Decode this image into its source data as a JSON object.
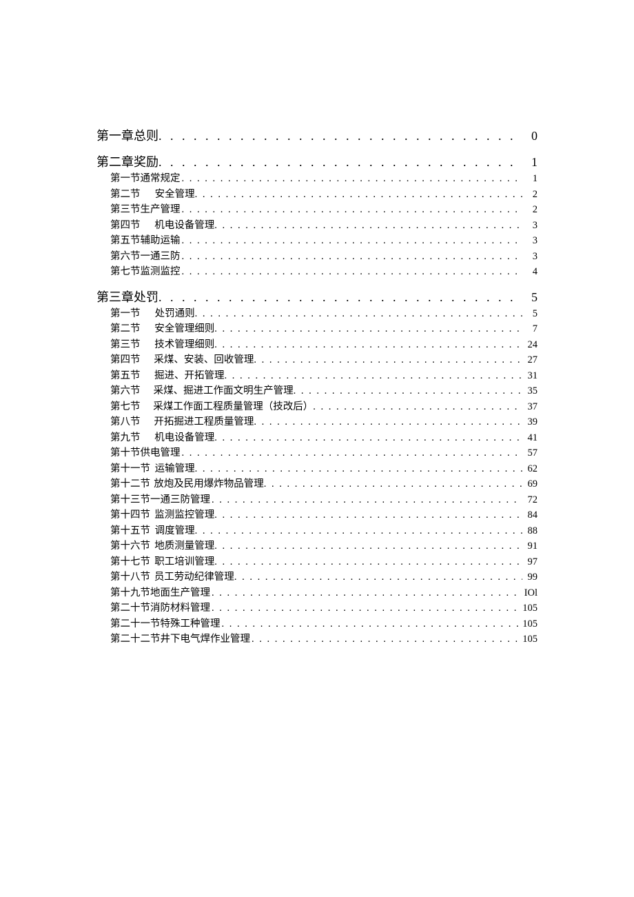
{
  "toc": [
    {
      "level": 0,
      "label": "第一章总则",
      "title": "",
      "page": "0",
      "tight": true
    },
    {
      "level": 0,
      "label": "第二章奖励",
      "title": "",
      "page": "1",
      "tight": true
    },
    {
      "level": 1,
      "label": "第一节通常规定",
      "title": "",
      "page": "1",
      "tight": true
    },
    {
      "level": 1,
      "label": "第二节",
      "title": "安全管理",
      "page": "2"
    },
    {
      "level": 1,
      "label": "第三节生产管理",
      "title": "",
      "page": "2",
      "tight": true
    },
    {
      "level": 1,
      "label": "第四节",
      "title": "机电设备管理",
      "page": "3"
    },
    {
      "level": 1,
      "label": "第五节辅助运输",
      "title": "",
      "page": "3",
      "tight": true
    },
    {
      "level": 1,
      "label": "第六节一通三防",
      "title": "",
      "page": "3",
      "tight": true
    },
    {
      "level": 1,
      "label": "第七节监测监控",
      "title": "",
      "page": "4",
      "tight": true
    },
    {
      "level": 0,
      "label": "第三章处罚",
      "title": "",
      "page": "5",
      "tight": true
    },
    {
      "level": 1,
      "label": "第一节",
      "title": "处罚通则",
      "page": "5"
    },
    {
      "level": 1,
      "label": "第二节",
      "title": "安全管理细则",
      "page": "7"
    },
    {
      "level": 1,
      "label": "第三节",
      "title": "技术管理细则",
      "page": "24"
    },
    {
      "level": 1,
      "label": "第四节",
      "title": "采煤、安装、回收管理",
      "page": "27"
    },
    {
      "level": 1,
      "label": "第五节",
      "title": "掘进、开拓管理",
      "page": "31"
    },
    {
      "level": 1,
      "label": "第六节",
      "title": "采煤、掘进工作面文明生产管理",
      "page": "35"
    },
    {
      "level": 1,
      "label": "第七节",
      "title": "采煤工作面工程质量管理（技改后）",
      "page": "37"
    },
    {
      "level": 1,
      "label": "第八节",
      "title": "开拓掘进工程质量管理",
      "page": "39"
    },
    {
      "level": 1,
      "label": "第九节",
      "title": "机电设备管理",
      "page": "41"
    },
    {
      "level": 1,
      "label": "第十节供电管理",
      "title": "",
      "page": "57",
      "tight": true
    },
    {
      "level": 1,
      "label": "第十一节",
      "title": "运输管理",
      "page": "62"
    },
    {
      "level": 1,
      "label": "第十二节",
      "title": "放炮及民用爆炸物品管理",
      "page": "69"
    },
    {
      "level": 1,
      "label": "第十三节一通三防管理",
      "title": "",
      "page": "72",
      "tight": true
    },
    {
      "level": 1,
      "label": "第十四节",
      "title": "监测监控管理",
      "page": "84"
    },
    {
      "level": 1,
      "label": "第十五节",
      "title": "调度管理",
      "page": "88"
    },
    {
      "level": 1,
      "label": "第十六节",
      "title": "地质测量管理",
      "page": "91"
    },
    {
      "level": 1,
      "label": "第十七节",
      "title": "职工培训管理",
      "page": "97"
    },
    {
      "level": 1,
      "label": "第十八节",
      "title": "员工劳动纪律管理",
      "page": "99"
    },
    {
      "level": 1,
      "label": "第十九节地面生产管理",
      "title": "",
      "page": "IOl",
      "tight": true
    },
    {
      "level": 1,
      "label": "第二十节消防材料管理",
      "title": "",
      "page": "105",
      "tight": true
    },
    {
      "level": 1,
      "label": "第二十一节特殊工种管理",
      "title": "",
      "page": "105",
      "tight": true
    },
    {
      "level": 1,
      "label": "第二十二节井下电气焊作业管理",
      "title": "",
      "page": "105",
      "tight": true
    }
  ]
}
